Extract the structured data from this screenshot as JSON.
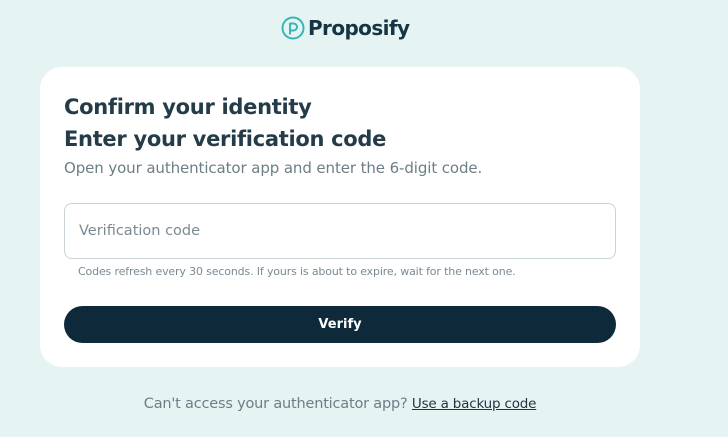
{
  "brand": {
    "name": "Proposify",
    "logo_icon": "proposify-p-icon",
    "accent_color": "#3ab5b5",
    "text_color": "#163544"
  },
  "card": {
    "title": "Confirm your identity",
    "subtitle": "Enter your verification code",
    "description": "Open your authenticator app and enter the 6-digit code.",
    "code_input": {
      "placeholder": "Verification code",
      "value": ""
    },
    "hint": "Codes refresh every 30 seconds. If yours is about to expire, wait for the next one.",
    "verify_label": "Verify",
    "button_color": "#0e2a3a"
  },
  "footer": {
    "prompt": "Can't access your authenticator app?",
    "backup_link": "Use a backup code"
  }
}
